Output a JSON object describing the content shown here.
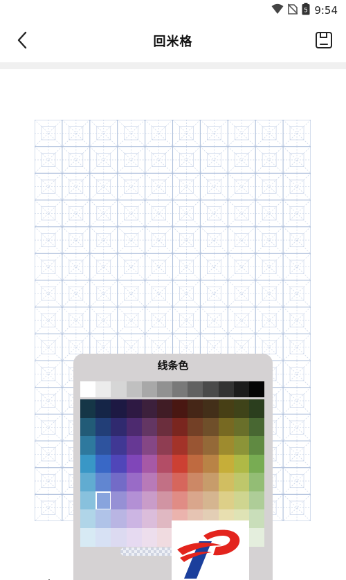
{
  "status_bar": {
    "time": "9:54",
    "battery_level": "5"
  },
  "app_bar": {
    "title": "回米格",
    "back_icon": "chevron-left-icon",
    "save_icon": "save-icon"
  },
  "grid": {
    "columns": 10,
    "rows": 15,
    "line_color": "#aebfdb",
    "guide_color": "#c8d4e8",
    "icon": "hui-mi-grid"
  },
  "picker": {
    "title": "线条色",
    "selected": {
      "row": 5,
      "col": 1
    },
    "grays": [
      "#ffffff",
      "#ececec",
      "#d6d6d6",
      "#c0c0c0",
      "#a8a8a8",
      "#919191",
      "#797979",
      "#616161",
      "#4a4a4a",
      "#333333",
      "#1c1c1c",
      "#050505"
    ],
    "hues": [
      {
        "name": "teal",
        "h": 200,
        "s": 55
      },
      {
        "name": "blue",
        "h": 220,
        "s": 55
      },
      {
        "name": "indigo",
        "h": 245,
        "s": 45
      },
      {
        "name": "purple",
        "h": 270,
        "s": 45
      },
      {
        "name": "plum",
        "h": 300,
        "s": 30
      },
      {
        "name": "maroon",
        "h": 345,
        "s": 40
      },
      {
        "name": "red",
        "h": 5,
        "s": 60
      },
      {
        "name": "rust",
        "h": 20,
        "s": 50
      },
      {
        "name": "brown",
        "h": 32,
        "s": 45
      },
      {
        "name": "olive",
        "h": 50,
        "s": 55
      },
      {
        "name": "olive-green",
        "h": 65,
        "s": 45
      },
      {
        "name": "green",
        "h": 95,
        "s": 35
      }
    ],
    "lightness": [
      18,
      30,
      40,
      50,
      60,
      70,
      80,
      90
    ]
  },
  "logo": {
    "icon": "brand-logo"
  }
}
